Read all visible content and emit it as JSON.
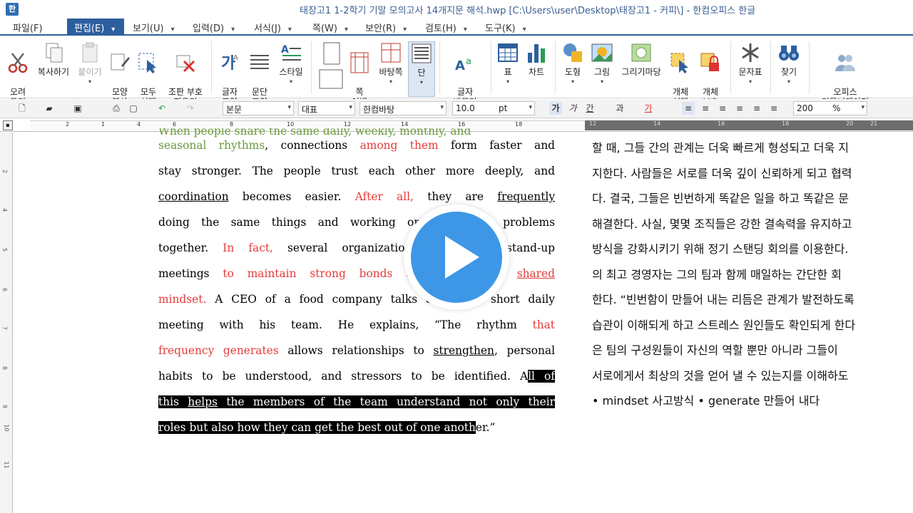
{
  "window": {
    "app_icon": "한",
    "title": "태장고1 1-2학기 기말 모의고사 14개지문 해석.hwp [C:\\Users\\user\\Desktop\\태장고1 - 커피\\] - 한컴오피스 한글"
  },
  "menu": [
    {
      "label": "파일(F)"
    },
    {
      "label": "편집(E)",
      "active": true
    },
    {
      "label": "보기(U)"
    },
    {
      "label": "입력(D)"
    },
    {
      "label": "서식(J)"
    },
    {
      "label": "쪽(W)"
    },
    {
      "label": "보안(R)"
    },
    {
      "label": "검토(H)"
    },
    {
      "label": "도구(K)"
    }
  ],
  "ribbon": {
    "cut": "오려\n두기",
    "copy": "복사하기",
    "paste": "붙이기",
    "format_copy": "모양\n복사",
    "select_all": "모두\n선택",
    "remove_symbols": "조판 부호\n지우기",
    "char_shape": "글자\n모양",
    "para_shape": "문단\n모양",
    "style": "스타일",
    "page_margin": "쪽\n여백",
    "background": "바탕쪽",
    "columns": "단",
    "change_char": "글자\n바꾸기",
    "table": "표",
    "chart": "차트",
    "shape": "도형",
    "picture": "그림",
    "draw_madang": "그리기마당",
    "object_select": "개체\n선택",
    "object_protect": "개체\n보호",
    "char_map": "문자표",
    "find": "찾기",
    "office_communicator": "오피스\n커뮤니케이터"
  },
  "format_bar": {
    "style": "본문",
    "font_lang": "대표",
    "font_name": "한컴바탕",
    "font_size": "10.0",
    "size_unit": "pt",
    "zoom": "200",
    "zoom_unit": "%"
  },
  "document": {
    "english_top_partial": "When people share the same daily, weekly, monthly, and",
    "english_lines": [
      [
        {
          "t": "seasonal rhythms",
          "c": "green"
        },
        {
          "t": ", connections "
        },
        {
          "t": "among them",
          "c": "red"
        },
        {
          "t": " form faster and"
        }
      ],
      [
        {
          "t": "stay stronger. The people trust each other more deeply, and"
        }
      ],
      [
        {
          "t": "coordination",
          "u": true
        },
        {
          "t": " becomes easier. "
        },
        {
          "t": "After all,",
          "c": "red"
        },
        {
          "t": " they are "
        },
        {
          "t": "frequently",
          "u": true
        }
      ],
      [
        {
          "t": "doing the same things and working on the same problems"
        }
      ],
      [
        {
          "t": "together. "
        },
        {
          "t": "In fact,",
          "c": "red"
        },
        {
          "t": " several organizations use daily stand-up"
        }
      ],
      [
        {
          "t": "meetings "
        },
        {
          "t": "to maintain strong bonds and develop a",
          "c": "red"
        },
        {
          "t": " "
        },
        {
          "t": "shared",
          "c": "red",
          "u": true
        }
      ],
      [
        {
          "t": "mindset.",
          "c": "red"
        },
        {
          "t": " A CEO of a food company talks about his short daily"
        }
      ],
      [
        {
          "t": "meeting with his team. He explains, “The rhythm "
        },
        {
          "t": "that",
          "c": "red"
        }
      ],
      [
        {
          "t": "frequency generates",
          "c": "red"
        },
        {
          "t": " allows relationships to "
        },
        {
          "t": "strengthen",
          "u": true
        },
        {
          "t": ", personal"
        }
      ],
      [
        {
          "t": "habits to be understood, and stressors to be identified. A"
        },
        {
          "t": "ll of",
          "sel": true
        }
      ],
      [
        {
          "t": "this ",
          "sel": true
        },
        {
          "t": "helps",
          "sel": true,
          "u": true
        },
        {
          "t": " the members of the team understand not only their",
          "sel": true
        }
      ],
      [
        {
          "t": "roles but also how they can get the best out of one anoth",
          "sel": true
        },
        {
          "t": "er.”"
        }
      ]
    ],
    "korean_lines": [
      "할 때, 그들 간의 관계는 더욱 빠르게 형성되고 더욱 지",
      "지한다. 사람들은 서로를 더욱 깊이 신뢰하게 되고 협력",
      "다. 결국, 그들은 빈번하게 똑같은 일을 하고 똑같은 문",
      "해결한다. 사실, 몇몇 조직들은 강한 결속력을 유지하고",
      "방식을 강화시키기 위해 정기 스탠딩 회의를 이용한다.",
      "의 최고 경영자는 그의 팀과 함께 매일하는 간단한 회",
      "한다. “빈번함이 만들어 내는 리듬은 관계가 발전하도록",
      "습관이 이해되게 하고 스트레스 원인들도 확인되게 한다",
      "은 팀의 구성원들이 자신의 역할 뿐만 아니라 그들이",
      "서로에게서 최상의 것을 얻어 낼 수 있는지를 이해하도",
      "• mindset 사고방식  • generate 만들어 내다"
    ]
  },
  "colors": {
    "accent": "#2d5f9e",
    "red_text": "#e53b3b",
    "green_text": "#6b9a3a",
    "play": "#3d97e6"
  }
}
